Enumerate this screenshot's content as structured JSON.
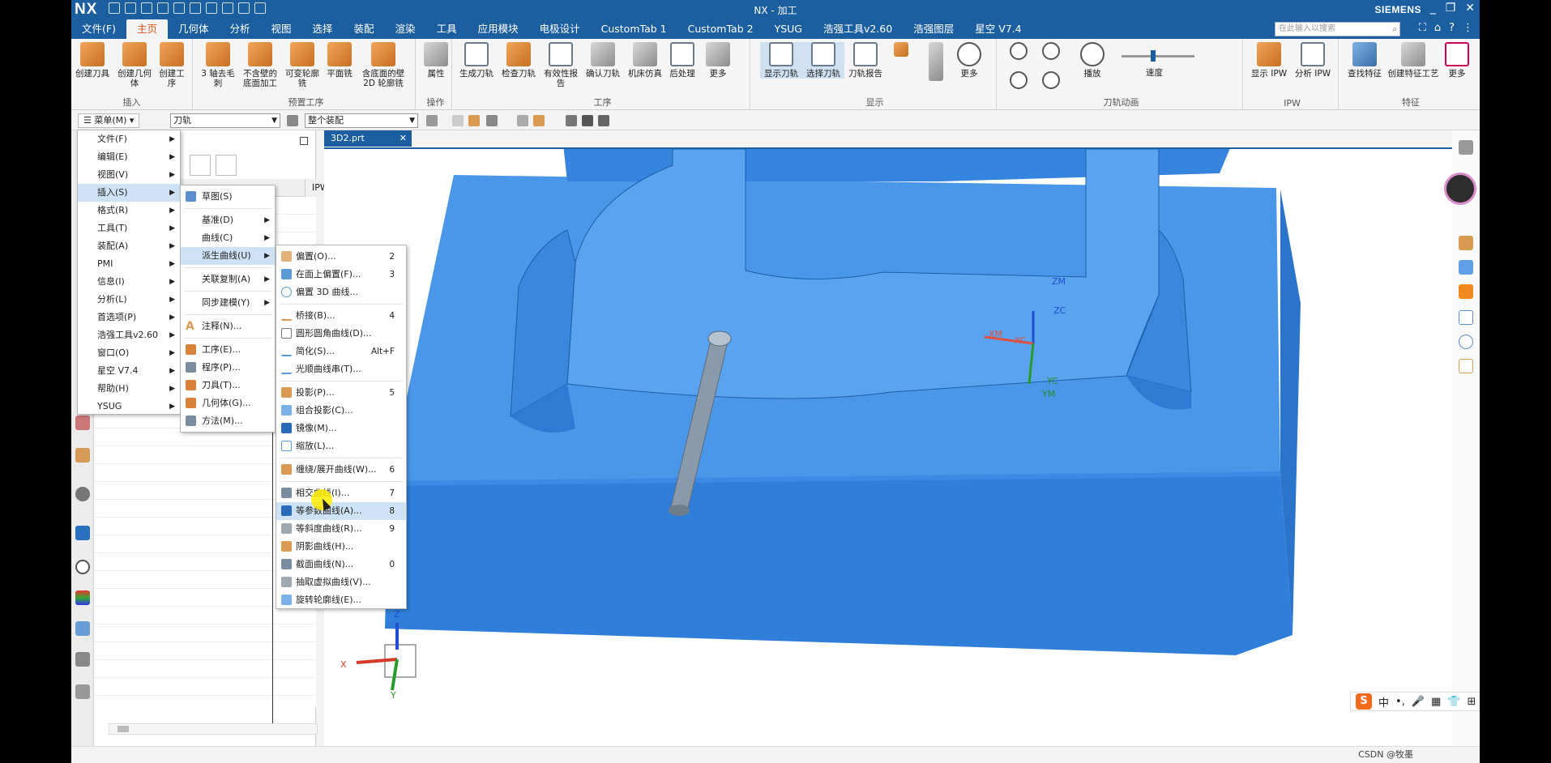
{
  "title_bar": {
    "logo": "NX",
    "title": "NX - 加工",
    "brand": "SIEMENS",
    "controls": [
      "_",
      "❐",
      "✕"
    ]
  },
  "tabs": [
    "文件(F)",
    "主页",
    "几何体",
    "分析",
    "视图",
    "选择",
    "装配",
    "渲染",
    "工具",
    "应用模块",
    "电极设计",
    "CustomTab 1",
    "CustomTab 2",
    "YSUG",
    "浩强工具v2.60",
    "浩强图层",
    "星空 V7.4"
  ],
  "search_placeholder": "在此输入以搜索",
  "ribbon": {
    "insert": {
      "label": "插入",
      "buttons": [
        "创建刀具",
        "创建几何体",
        "创建工序"
      ]
    },
    "predef": {
      "label": "预置工序",
      "buttons": [
        "3 轴去毛刺",
        "不含壁的底面加工",
        "可变轮廓铣",
        "平面铣",
        "含底面的壁 2D 轮廓铣"
      ]
    },
    "ops": {
      "label": "操作",
      "buttons": [
        "属性"
      ]
    },
    "gongxu": {
      "label": "工序",
      "buttons": [
        "生成刀轨",
        "检查刀轨",
        "有效性报告",
        "确认刀轨",
        "机床仿真",
        "后处理",
        "更多"
      ]
    },
    "display": {
      "label": "显示",
      "buttons": [
        "显示刀轨",
        "选择刀轨",
        "刀轨报告",
        "更多"
      ]
    },
    "anim": {
      "label": "刀轨动画",
      "buttons": [
        "播放",
        "速度"
      ]
    },
    "ipw": {
      "label": "IPW",
      "buttons": [
        "显示 IPW",
        "分析 IPW"
      ]
    },
    "feature": {
      "label": "特征",
      "buttons": [
        "查找特征",
        "创建特征工艺",
        "更多"
      ]
    }
  },
  "cmdbar": {
    "menu_label": "菜单(M)",
    "filter_value": "刀轨",
    "scope_value": "整个装配"
  },
  "nav": {
    "ipw_col": "IPW"
  },
  "doc_tab": "3D2.prt",
  "main_menu": [
    "文件(F)",
    "编辑(E)",
    "视图(V)",
    "插入(S)",
    "格式(R)",
    "工具(T)",
    "装配(A)",
    "PMI",
    "信息(I)",
    "分析(L)",
    "首选项(P)",
    "浩强工具v2.60",
    "窗口(O)",
    "星空 V7.4",
    "帮助(H)",
    "YSUG"
  ],
  "insert_menu": {
    "top": [
      "草图(S)"
    ],
    "mid": [
      "基准(D)",
      "曲线(C)",
      "派生曲线(U)"
    ],
    "mid2": [
      "关联复制(A)",
      "同步建模(Y)"
    ],
    "note": [
      "注释(N)..."
    ],
    "bottom": [
      "工序(E)...",
      "程序(P)...",
      "刀具(T)...",
      "几何体(G)...",
      "方法(M)..."
    ]
  },
  "derived_menu": {
    "g1": [
      {
        "label": "偏置(O)...",
        "key": "2"
      },
      {
        "label": "在面上偏置(F)...",
        "key": "3"
      },
      {
        "label": "偏置 3D 曲线...",
        "key": ""
      }
    ],
    "g2": [
      {
        "label": "桥接(B)...",
        "key": "4"
      },
      {
        "label": "圆形圆角曲线(D)...",
        "key": ""
      },
      {
        "label": "简化(S)...",
        "key": "Alt+F"
      },
      {
        "label": "光顺曲线串(T)...",
        "key": ""
      }
    ],
    "g3": [
      {
        "label": "投影(P)...",
        "key": "5"
      },
      {
        "label": "组合投影(C)...",
        "key": ""
      },
      {
        "label": "镜像(M)...",
        "key": ""
      },
      {
        "label": "缩放(L)...",
        "key": ""
      }
    ],
    "g4": [
      {
        "label": "缠绕/展开曲线(W)...",
        "key": "6"
      }
    ],
    "g5": [
      {
        "label": "相交曲线(I)...",
        "key": "7"
      },
      {
        "label": "等参数曲线(A)...",
        "key": "8"
      },
      {
        "label": "等斜度曲线(R)...",
        "key": "9"
      },
      {
        "label": "阴影曲线(H)...",
        "key": ""
      },
      {
        "label": "截面曲线(N)...",
        "key": "0"
      },
      {
        "label": "抽取虚拟曲线(V)...",
        "key": ""
      },
      {
        "label": "旋转轮廓线(E)...",
        "key": ""
      }
    ]
  },
  "triad": {
    "zm": "ZM",
    "zc": "ZC",
    "xm": "XM",
    "xc": "XC",
    "yc": "YC",
    "ym": "YM"
  },
  "wcs": {
    "z": "Z",
    "x": "X",
    "y": "Y"
  },
  "ime": [
    "中",
    "•,",
    "🎤",
    "▦",
    "👕",
    "⊞"
  ],
  "watermark": "CSDN @牧墨",
  "colors": {
    "accent": "#1c5fa0",
    "model": "#3f8fe6",
    "active_tab": "#d8551e"
  }
}
